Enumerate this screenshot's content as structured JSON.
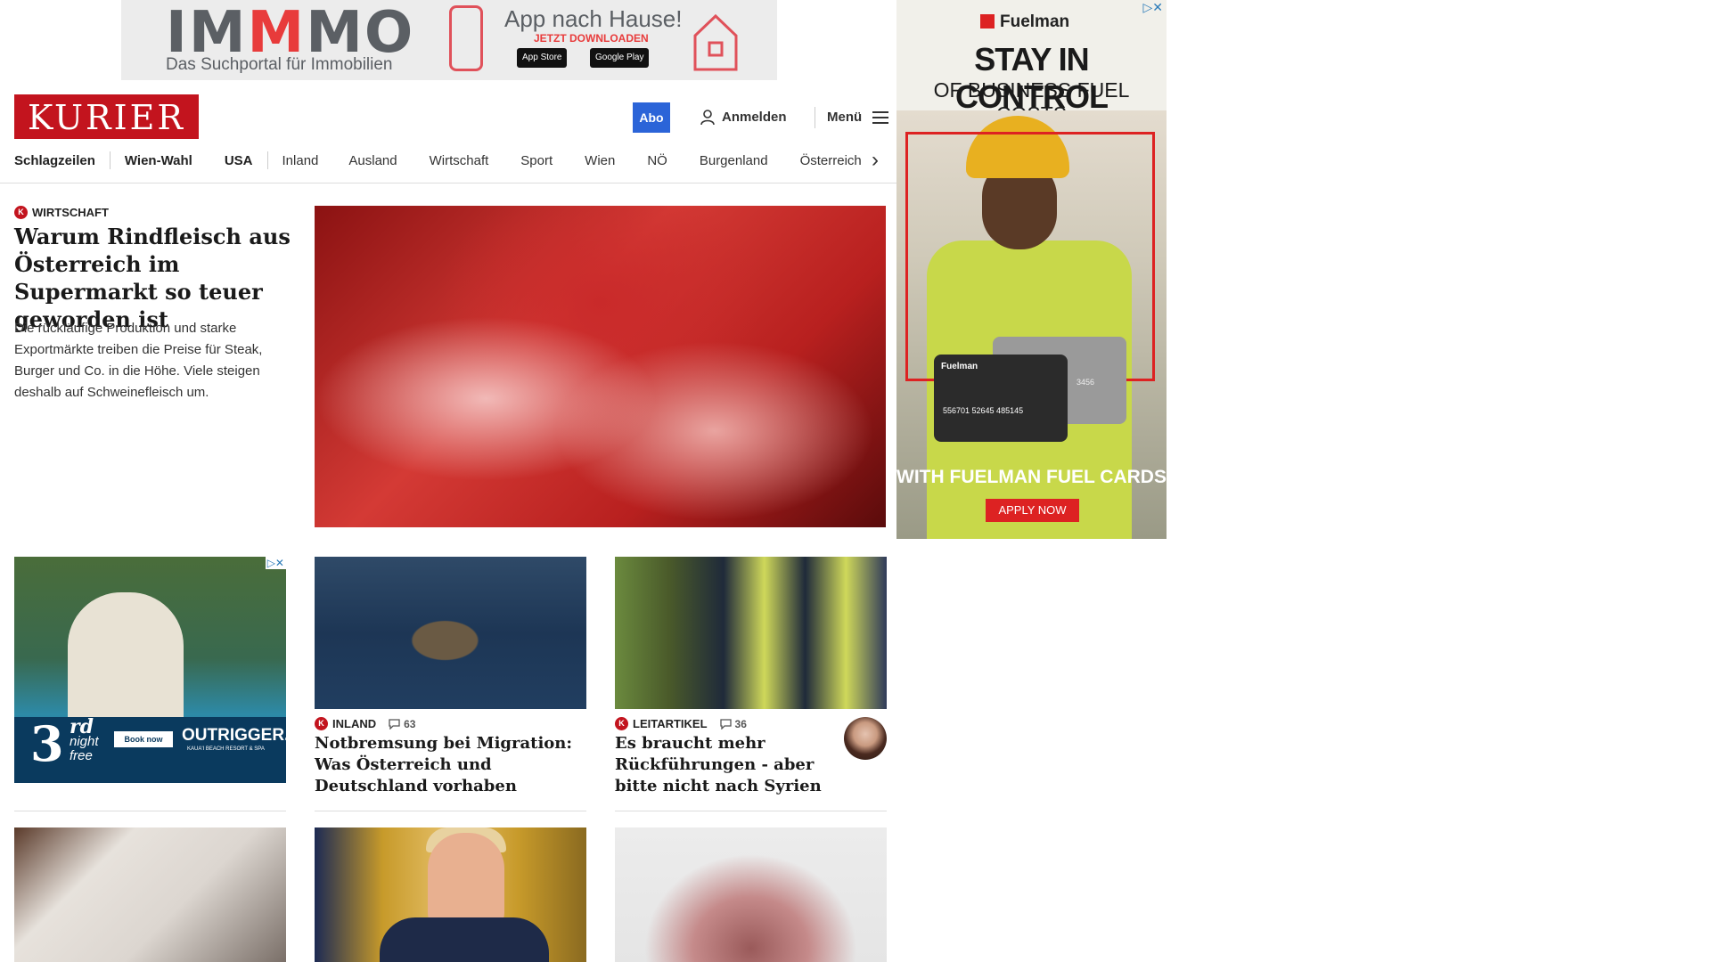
{
  "top_ad": {
    "brand_parts": [
      "IM",
      "M",
      "MO"
    ],
    "brand_sub": "Das Suchportal für Immobilien",
    "app_title": "App nach Hause!",
    "app_sub": "JETZT DOWNLOADEN",
    "store_1": "App Store",
    "store_2": "Google Play"
  },
  "side_ad": {
    "brand": "Fuelman",
    "headline": "STAY IN CONTROL",
    "subheadline": "OF BUSINESS FUEL COSTS",
    "card_brand": "Fuelman",
    "card_number": "556701 52645 485145",
    "card_digits": "3456",
    "cta_text": "WITH FUELMAN FUEL CARDS",
    "cta_button": "APPLY NOW",
    "accent_color": "#d22222"
  },
  "header": {
    "logo": "KURIER",
    "abo": "Abo",
    "login": "Anmelden",
    "menu": "Menü"
  },
  "nav": {
    "items": [
      "Schlagzeilen",
      "Wien-Wahl",
      "USA",
      "Inland",
      "Ausland",
      "Wirtschaft",
      "Sport",
      "Wien",
      "NÖ",
      "Burgenland",
      "Österreich"
    ]
  },
  "lead": {
    "kicker": "WIRTSCHAFT",
    "title": "Warum Rindfleisch aus Österreich im Supermarkt so teuer geworden ist",
    "teaser": "Die rückläufige Produktion und starke Exportmärkte treiben die Preise für Steak, Burger und Co. in die Höhe. Viele steigen deshalb auf Schweinefleisch um."
  },
  "ad2": {
    "num": "3",
    "suffix": "rd",
    "line1": "night",
    "line2": "free",
    "book": "Book now",
    "brand": "OUTRIGGER.",
    "brand_sub": "KAUA'I BEACH RESORT & SPA"
  },
  "cards": [
    {
      "kicker": "INLAND",
      "comments": "63",
      "title": "Notbremsung bei Migration: Was Österreich und Deutschland vorhaben"
    },
    {
      "kicker": "LEITARTIKEL",
      "comments": "36",
      "title": "Es braucht mehr Rückführungen - aber bitte nicht nach Syrien"
    }
  ],
  "icons": {
    "kurier_badge": "K",
    "nav_arrow": "›"
  },
  "colors": {
    "brand_red": "#c3141e",
    "abo_blue": "#2b64d8"
  }
}
